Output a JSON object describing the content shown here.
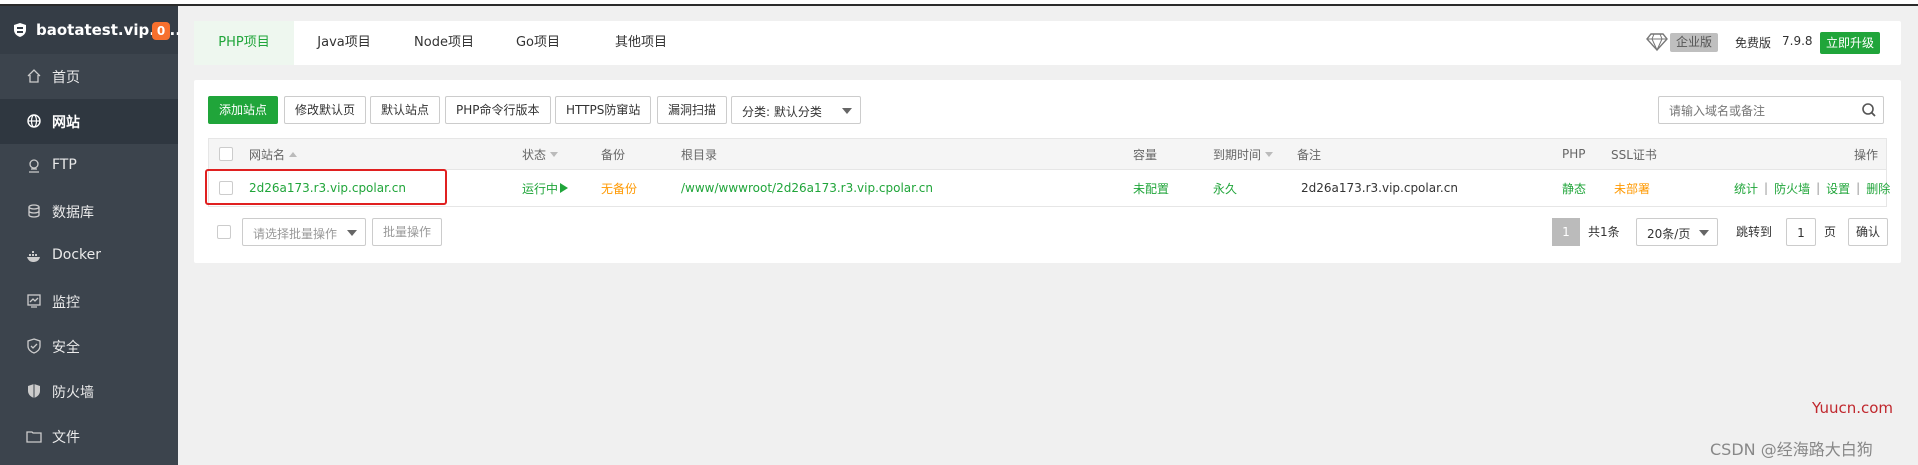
{
  "sidebar": {
    "site_name": "baotatest.vip.c...",
    "badge": "0",
    "items": [
      {
        "label": "首页",
        "icon": "home-icon"
      },
      {
        "label": "网站",
        "icon": "globe-icon"
      },
      {
        "label": "FTP",
        "icon": "ftp-icon"
      },
      {
        "label": "数据库",
        "icon": "database-icon"
      },
      {
        "label": "Docker",
        "icon": "docker-icon"
      },
      {
        "label": "监控",
        "icon": "monitor-icon"
      },
      {
        "label": "安全",
        "icon": "shield-check-icon"
      },
      {
        "label": "防火墙",
        "icon": "firewall-icon"
      },
      {
        "label": "文件",
        "icon": "folder-icon"
      }
    ],
    "active_index": 1
  },
  "tabs": [
    "PHP项目",
    "Java项目",
    "Node项目",
    "Go项目",
    "其他项目"
  ],
  "header": {
    "enterprise": "企业版",
    "free": "免费版",
    "version": "7.9.8",
    "upgrade": "立即升级"
  },
  "toolbar": {
    "add_site": "添加站点",
    "modify_default_page": "修改默认页",
    "default_site": "默认站点",
    "php_cli_version": "PHP命令行版本",
    "https_anti_hijack": "HTTPS防窜站",
    "vuln_scan": "漏洞扫描",
    "category_select": "分类: 默认分类",
    "search_placeholder": "请输入域名或备注"
  },
  "table": {
    "headers": {
      "name": "网站名",
      "status": "状态",
      "backup": "备份",
      "root": "根目录",
      "quota": "容量",
      "expire": "到期时间",
      "remark": "备注",
      "php": "PHP",
      "ssl": "SSL证书",
      "action": "操作"
    },
    "rows": [
      {
        "name": "2d26a173.r3.vip.cpolar.cn",
        "status": "运行中",
        "backup": "无备份",
        "root": "/www/wwwroot/2d26a173.r3.vip.cpolar.cn",
        "quota": "未配置",
        "expire": "永久",
        "remark": "2d26a173.r3.vip.cpolar.cn",
        "php": "静态",
        "ssl": "未部署",
        "actions": {
          "stats": "统计",
          "firewall": "防火墙",
          "settings": "设置",
          "delete": "删除"
        }
      }
    ]
  },
  "footer": {
    "batch_placeholder": "请选择批量操作",
    "batch_btn": "批量操作",
    "current_page": "1",
    "total": "共1条",
    "page_size": "20条/页",
    "jump_to": "跳转到",
    "jump_value": "1",
    "page_unit": "页",
    "confirm": "确认"
  },
  "watermarks": {
    "site": "Yuucn.com",
    "csdn": "CSDN @经海路大白狗"
  },
  "colors": {
    "accent": "#20a53a",
    "sidebar": "#3c444d",
    "warning": "#ff9900",
    "badge": "#f7702e"
  }
}
